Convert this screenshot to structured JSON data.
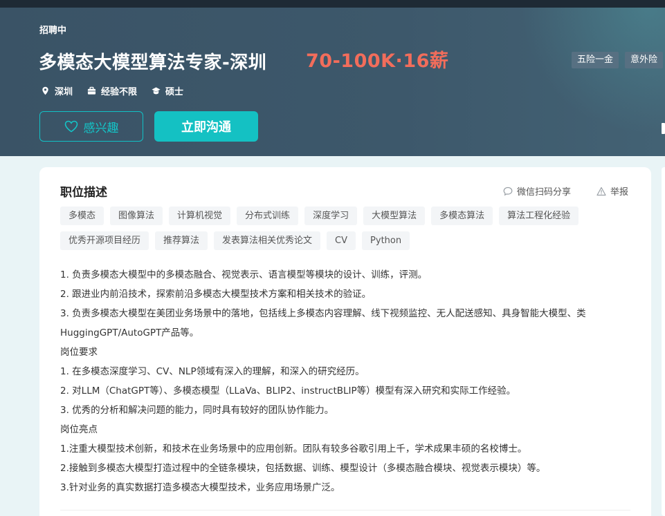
{
  "job": {
    "status": "招聘中",
    "title": "多模态大模型算法专家-深圳",
    "salary": "70-100K·16薪",
    "meta": {
      "city": "深圳",
      "experience": "经验不限",
      "degree": "硕士"
    },
    "benefits": [
      "五险一金",
      "意外险"
    ]
  },
  "actions": {
    "interest_label": "感兴趣",
    "chat_label": "立即沟通"
  },
  "section": {
    "title": "职位描述",
    "share_label": "微信扫码分享",
    "report_label": "举报"
  },
  "tags": [
    "多模态",
    "图像算法",
    "计算机视觉",
    "分布式训练",
    "深度学习",
    "大模型算法",
    "多模态算法",
    "算法工程化经验",
    "优秀开源项目经历",
    "推荐算法",
    "发表算法相关优秀论文",
    "CV",
    "Python"
  ],
  "description": [
    "1. 负责多模态大模型中的多模态融合、视觉表示、语言模型等模块的设计、训练，评测。",
    "2. 跟进业内前沿技术，探索前沿多模态大模型技术方案和相关技术的验证。",
    "3. 负责多模态大模型在美团业务场景中的落地，包括线上多模态内容理解、线下视频监控、无人配送感知、具身智能大模型、类HuggingGPT/AutoGPT产品等。",
    "岗位要求",
    "1. 在多模态深度学习、CV、NLP领域有深入的理解，和深入的研究经历。",
    "2. 对LLM（ChatGPT等）、多模态模型（LLaVa、BLIP2、instructBLIP等）模型有深入研究和实际工作经验。",
    "3. 优秀的分析和解决问题的能力，同时具有较好的团队协作能力。",
    "岗位亮点",
    "1.注重大模型技术创新，和技术在业务场景中的应用创新。团队有较多谷歌引用上千，学术成果丰硕的名校博士。",
    "2.接触到多模态大模型打造过程中的全链条模块，包括数据、训练、模型设计（多模态融合模块、视觉表示模块）等。",
    "3.针对业务的真实数据打造多模态大模型技术，业务应用场景广泛。"
  ],
  "colors": {
    "header_bg": "#3d586b",
    "accent": "#14c1c3",
    "salary": "#f26d5b"
  },
  "icons": {
    "city": "location-pin-icon",
    "experience": "briefcase-icon",
    "degree": "graduation-cap-icon",
    "interest": "heart-icon",
    "share": "chat-bubble-icon",
    "report": "warning-icon"
  }
}
